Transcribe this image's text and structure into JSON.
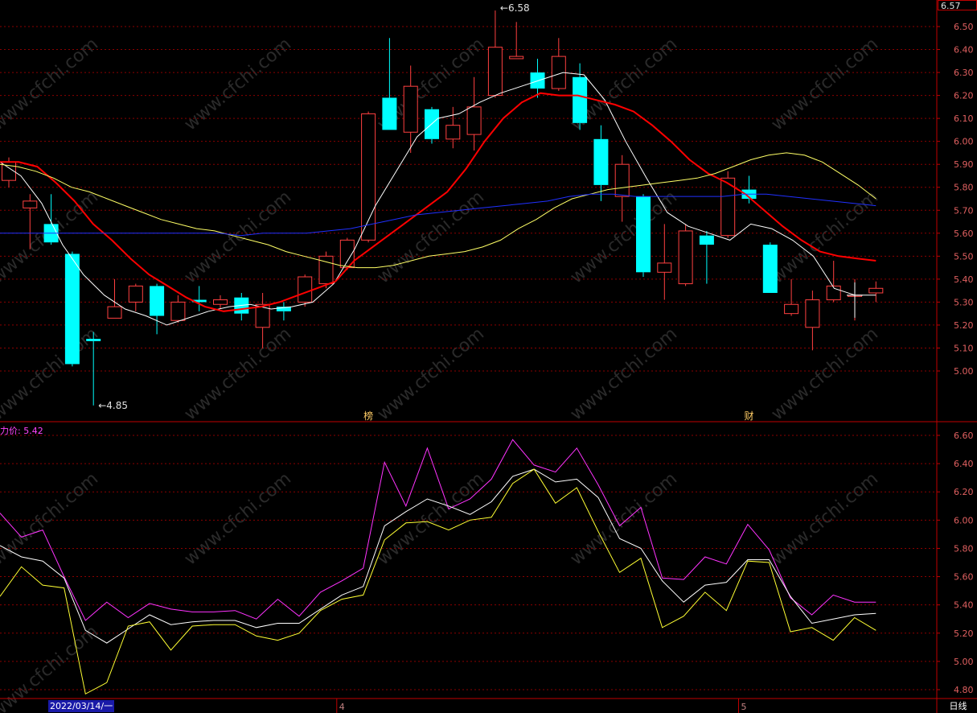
{
  "header": {
    "last_price": "6.57",
    "lower_title": "力价: 5.42"
  },
  "footer": {
    "date_label": "2022/03/14/一",
    "month_labels": [
      "4",
      "5"
    ],
    "period_label": "日线"
  },
  "watermark": "www.cfchi.com",
  "colors": {
    "background": "#000000",
    "grid": "#8b0000",
    "axis": "#c00000",
    "up": "#ff4040",
    "down": "#00ffff",
    "ma5": "#ffffff",
    "ma10": "#ff0000",
    "ma20": "#ffff66",
    "ma60": "#2030ff",
    "lower_magenta": "#ff33ff",
    "lower_white": "#ffffff",
    "lower_yellow": "#ffff33"
  },
  "chart_data": [
    {
      "type": "candlestick",
      "title": "",
      "ylim": [
        4.75,
        6.57
      ],
      "yticks": [
        "6.50",
        "6.40",
        "6.30",
        "6.20",
        "6.10",
        "6.00",
        "5.90",
        "5.80",
        "5.70",
        "5.60",
        "5.50",
        "5.40",
        "5.30",
        "5.20",
        "5.10",
        "5.00"
      ],
      "candles": [
        {
          "o": 5.83,
          "c": 5.91,
          "h": 5.93,
          "l": 5.8
        },
        {
          "o": 5.71,
          "c": 5.74,
          "h": 5.77,
          "l": 5.53
        },
        {
          "o": 5.64,
          "c": 5.56,
          "h": 5.77,
          "l": 5.55
        },
        {
          "o": 5.51,
          "c": 5.03,
          "h": 5.52,
          "l": 5.02
        },
        {
          "o": 5.14,
          "c": 5.13,
          "h": 5.17,
          "l": 4.85
        },
        {
          "o": 5.23,
          "c": 5.28,
          "h": 5.4,
          "l": 5.23
        },
        {
          "o": 5.3,
          "c": 5.37,
          "h": 5.38,
          "l": 5.26
        },
        {
          "o": 5.37,
          "c": 5.24,
          "h": 5.38,
          "l": 5.16
        },
        {
          "o": 5.22,
          "c": 5.3,
          "h": 5.33,
          "l": 5.21
        },
        {
          "o": 5.31,
          "c": 5.3,
          "h": 5.37,
          "l": 5.26
        },
        {
          "o": 5.29,
          "c": 5.31,
          "h": 5.33,
          "l": 5.27
        },
        {
          "o": 5.32,
          "c": 5.25,
          "h": 5.34,
          "l": 5.22
        },
        {
          "o": 5.19,
          "c": 5.29,
          "h": 5.34,
          "l": 5.1
        },
        {
          "o": 5.28,
          "c": 5.26,
          "h": 5.3,
          "l": 5.22
        },
        {
          "o": 5.3,
          "c": 5.41,
          "h": 5.42,
          "l": 5.28
        },
        {
          "o": 5.38,
          "c": 5.5,
          "h": 5.52,
          "l": 5.36
        },
        {
          "o": 5.45,
          "c": 5.57,
          "h": 5.58,
          "l": 5.44
        },
        {
          "o": 5.57,
          "c": 6.12,
          "h": 6.13,
          "l": 5.56
        },
        {
          "o": 6.19,
          "c": 6.05,
          "h": 6.45,
          "l": 6.05
        },
        {
          "o": 6.04,
          "c": 6.24,
          "h": 6.33,
          "l": 5.95
        },
        {
          "o": 6.14,
          "c": 6.01,
          "h": 6.15,
          "l": 5.99
        },
        {
          "o": 6.01,
          "c": 6.07,
          "h": 6.15,
          "l": 5.97
        },
        {
          "o": 6.03,
          "c": 6.15,
          "h": 6.28,
          "l": 5.96
        },
        {
          "o": 6.2,
          "c": 6.41,
          "h": 6.57,
          "l": 6.19
        },
        {
          "o": 6.36,
          "c": 6.37,
          "h": 6.52,
          "l": 6.36
        },
        {
          "o": 6.3,
          "c": 6.23,
          "h": 6.36,
          "l": 6.19
        },
        {
          "o": 6.23,
          "c": 6.37,
          "h": 6.45,
          "l": 6.22
        },
        {
          "o": 6.28,
          "c": 6.08,
          "h": 6.34,
          "l": 6.05
        },
        {
          "o": 6.01,
          "c": 5.81,
          "h": 6.07,
          "l": 5.74
        },
        {
          "o": 5.76,
          "c": 5.9,
          "h": 5.94,
          "l": 5.65
        },
        {
          "o": 5.76,
          "c": 5.43,
          "h": 5.77,
          "l": 5.41
        },
        {
          "o": 5.43,
          "c": 5.47,
          "h": 5.64,
          "l": 5.31
        },
        {
          "o": 5.38,
          "c": 5.61,
          "h": 5.64,
          "l": 5.37
        },
        {
          "o": 5.59,
          "c": 5.55,
          "h": 5.61,
          "l": 5.38
        },
        {
          "o": 5.59,
          "c": 5.84,
          "h": 5.87,
          "l": 5.58
        },
        {
          "o": 5.79,
          "c": 5.75,
          "h": 5.85,
          "l": 5.73
        },
        {
          "o": 5.55,
          "c": 5.34,
          "h": 5.56,
          "l": 5.34
        },
        {
          "o": 5.25,
          "c": 5.29,
          "h": 5.4,
          "l": 5.24
        },
        {
          "o": 5.19,
          "c": 5.31,
          "h": 5.35,
          "l": 5.09
        },
        {
          "o": 5.31,
          "c": 5.37,
          "h": 5.48,
          "l": 5.3
        },
        {
          "o": 5.33,
          "c": 5.33,
          "h": 5.4,
          "l": 5.22
        },
        {
          "o": 5.34,
          "c": 5.36,
          "h": 5.39,
          "l": 5.3
        }
      ],
      "series": [
        {
          "values": [
            5.91,
            5.85,
            5.73,
            5.55,
            5.42,
            5.33,
            5.27,
            5.24,
            5.2,
            5.23,
            5.26,
            5.28,
            5.29,
            5.27,
            5.28,
            5.3,
            5.38,
            5.53,
            5.72,
            5.87,
            6.02,
            6.1,
            6.12,
            6.17,
            6.21,
            6.24,
            6.27,
            6.3,
            6.29,
            6.18,
            6.0,
            5.84,
            5.69,
            5.63,
            5.6,
            5.57,
            5.64,
            5.62,
            5.57,
            5.5,
            5.36,
            5.33,
            5.33
          ]
        },
        {
          "values": [
            5.91,
            5.91,
            5.89,
            5.82,
            5.74,
            5.64,
            5.57,
            5.49,
            5.42,
            5.37,
            5.32,
            5.28,
            5.26,
            5.27,
            5.28,
            5.3,
            5.33,
            5.36,
            5.39,
            5.48,
            5.54,
            5.6,
            5.66,
            5.72,
            5.78,
            5.88,
            6.0,
            6.1,
            6.17,
            6.21,
            6.2,
            6.2,
            6.18,
            6.16,
            6.13,
            6.07,
            6.0,
            5.92,
            5.86,
            5.82,
            5.77,
            5.7,
            5.63,
            5.57,
            5.52,
            5.5,
            5.49,
            5.48
          ]
        },
        {
          "values": [
            5.9,
            5.89,
            5.87,
            5.84,
            5.8,
            5.78,
            5.75,
            5.72,
            5.69,
            5.66,
            5.64,
            5.62,
            5.61,
            5.59,
            5.57,
            5.55,
            5.52,
            5.5,
            5.48,
            5.46,
            5.45,
            5.45,
            5.46,
            5.48,
            5.5,
            5.51,
            5.52,
            5.54,
            5.57,
            5.62,
            5.66,
            5.71,
            5.75,
            5.77,
            5.79,
            5.8,
            5.81,
            5.82,
            5.83,
            5.84,
            5.86,
            5.89,
            5.92,
            5.94,
            5.95,
            5.94,
            5.91,
            5.86,
            5.81,
            5.75
          ]
        },
        {
          "values": [
            5.6,
            5.6,
            5.6,
            5.6,
            5.6,
            5.6,
            5.6,
            5.6,
            5.6,
            5.6,
            5.6,
            5.59,
            5.6,
            5.6,
            5.6,
            5.61,
            5.62,
            5.64,
            5.66,
            5.68,
            5.69,
            5.7,
            5.71,
            5.72,
            5.73,
            5.74,
            5.76,
            5.77,
            5.77,
            5.76,
            5.76,
            5.76,
            5.76,
            5.76,
            5.77,
            5.77,
            5.76,
            5.75,
            5.74,
            5.73,
            5.72
          ]
        }
      ],
      "annotations": [
        {
          "text": "6.58",
          "x": 23,
          "y": 6.58
        },
        {
          "text": "4.85",
          "x": 4,
          "y": 4.85
        },
        {
          "text": "榜",
          "x": 17,
          "y": 4.75
        },
        {
          "text": "财",
          "x": 35,
          "y": 4.75
        }
      ]
    },
    {
      "type": "line",
      "title": "力价: 5.42",
      "ylim": [
        4.75,
        6.65
      ],
      "yticks": [
        "6.60",
        "6.40",
        "6.20",
        "6.00",
        "5.80",
        "5.60",
        "5.40",
        "5.20",
        "5.00",
        "4.80"
      ],
      "series": [
        {
          "values": [
            6.05,
            5.88,
            5.93,
            5.6,
            5.29,
            5.42,
            5.31,
            5.41,
            5.37,
            5.35,
            5.35,
            5.36,
            5.3,
            5.44,
            5.32,
            5.49,
            5.57,
            5.66,
            6.41,
            6.1,
            6.51,
            6.08,
            6.15,
            6.29,
            6.57,
            6.39,
            6.34,
            6.51,
            6.25,
            5.96,
            6.09,
            5.59,
            5.58,
            5.74,
            5.69,
            5.97,
            5.79,
            5.45,
            5.33,
            5.47,
            5.42,
            5.42
          ]
        },
        {
          "values": [
            5.82,
            5.74,
            5.71,
            5.59,
            5.22,
            5.13,
            5.23,
            5.33,
            5.26,
            5.28,
            5.29,
            5.29,
            5.24,
            5.27,
            5.27,
            5.37,
            5.47,
            5.53,
            5.96,
            6.06,
            6.15,
            6.1,
            6.04,
            6.13,
            6.31,
            6.36,
            6.27,
            6.29,
            6.16,
            5.87,
            5.8,
            5.57,
            5.42,
            5.54,
            5.56,
            5.72,
            5.72,
            5.46,
            5.27,
            5.3,
            5.33,
            5.34
          ]
        },
        {
          "values": [
            5.46,
            5.67,
            5.54,
            5.52,
            4.77,
            4.85,
            5.25,
            5.28,
            5.08,
            5.25,
            5.26,
            5.26,
            5.18,
            5.15,
            5.2,
            5.36,
            5.44,
            5.47,
            5.86,
            5.98,
            5.99,
            5.93,
            6.0,
            6.02,
            6.26,
            6.36,
            6.12,
            6.23,
            5.92,
            5.63,
            5.73,
            5.24,
            5.32,
            5.49,
            5.36,
            5.71,
            5.7,
            5.21,
            5.24,
            5.15,
            5.31,
            5.22
          ]
        }
      ]
    }
  ]
}
